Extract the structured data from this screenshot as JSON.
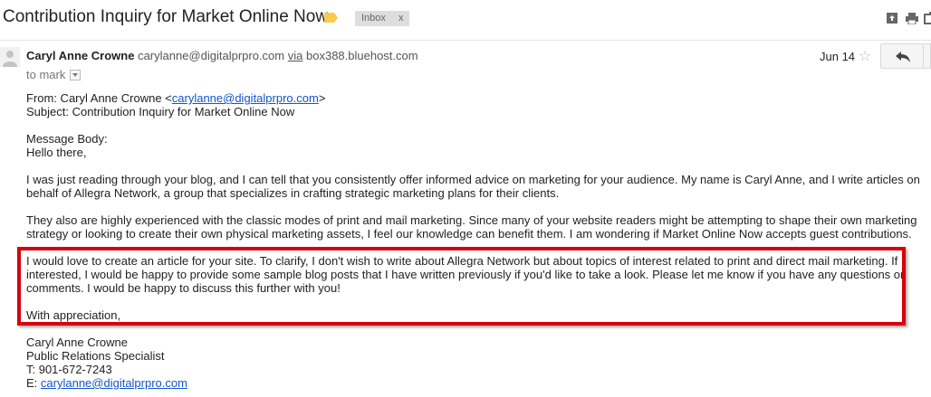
{
  "subject": {
    "title": "Contribution Inquiry for Market Online Now",
    "label_chip": "Inbox",
    "label_remove": "x"
  },
  "header": {
    "sender_name": "Caryl Anne Crowne",
    "sender_email": "carylanne@digitalprpro.com",
    "via_label": "via",
    "via_host": "box388.bluehost.com",
    "to": "to mark",
    "date": "Jun 14",
    "star": "☆"
  },
  "body": {
    "from_prefix": "From: Caryl Anne Crowne <",
    "from_email": "carylanne@digitalprpro.com",
    "from_suffix": ">",
    "subject_line": "Subject: Contribution Inquiry for Market Online Now",
    "message_body_label": "Message Body:",
    "greeting": "Hello there,",
    "p1_line1": "I was just reading through your blog, and I can tell that you consistently offer informed advice on marketing for your audience. My name is Caryl Anne, and I write articles on",
    "p1_line2": "behalf of Allegra Network, a group that specializes in crafting strategic marketing plans for their clients.",
    "p2_line1": "They also are highly experienced with the classic modes of print and mail marketing. Since many of your website readers might be attempting to shape their own marketing",
    "p2_line2": "strategy or looking to create their own physical marketing assets, I feel our knowledge can benefit them. I am wondering if Market Online Now accepts guest contributions.",
    "p3_line1": "I would love to create an article for your site. To clarify, I don't wish to write about Allegra Network but about topics of interest related to print and direct mail marketing. If",
    "p3_line2": "interested, I would be happy to provide some sample blog posts that I have written previously if you'd like to take a look. Please let me know if you have any questions or",
    "p3_line3": "comments. I would be happy to discuss this further with you!",
    "closing": "With appreciation,",
    "sig_name": "Caryl Anne Crowne",
    "sig_title": "Public Relations Specialist",
    "sig_phone": "T: 901-672-7243",
    "sig_email_prefix": "E: ",
    "sig_email": "carylanne@digitalprpro.com"
  },
  "colors": {
    "highlight_border": "#d7000f",
    "link": "#1155cc",
    "label_tag": "#f7cb4d"
  },
  "icons": [
    "label-tag-icon",
    "new-window-icon",
    "print-icon",
    "popout-icon",
    "avatar-icon",
    "star-icon",
    "reply-icon"
  ]
}
